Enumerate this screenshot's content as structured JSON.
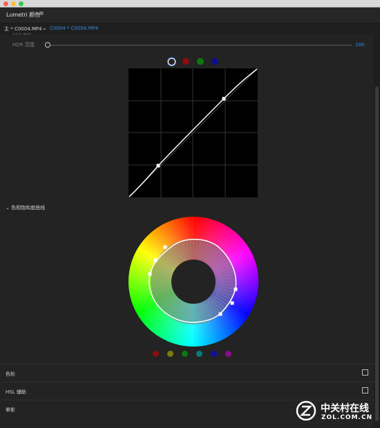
{
  "panel": {
    "title": "Lumetri 颜色",
    "menu_icon": "hamburger-menu-icon"
  },
  "clip_bar": {
    "main_clip": "主 * C0004.MP4",
    "active_clip": "C0004 * C0004.MP4"
  },
  "hdr": {
    "clipped_label": "RGB 曲线",
    "label": "HDR 范围",
    "value": "100"
  },
  "rgb_curves": {
    "channels": [
      {
        "name": "white-channel",
        "color": "#ffffff",
        "selected": true
      },
      {
        "name": "red-channel",
        "color": "#8b0d0d",
        "selected": false
      },
      {
        "name": "green-channel",
        "color": "#0b7a0b",
        "selected": false
      },
      {
        "name": "blue-channel",
        "color": "#0d0d8b",
        "selected": false
      }
    ]
  },
  "hue_sat": {
    "title": "色相饱和度曲线",
    "hue_dots": [
      {
        "name": "red-hue",
        "color": "#8b0d0d"
      },
      {
        "name": "yellow-hue",
        "color": "#7f7a0b"
      },
      {
        "name": "green-hue",
        "color": "#0b7a0b"
      },
      {
        "name": "cyan-hue",
        "color": "#0a7a7a"
      },
      {
        "name": "blue-hue",
        "color": "#0f0fa0"
      },
      {
        "name": "magenta-hue",
        "color": "#8b0b8b"
      }
    ]
  },
  "sections": {
    "color_wheels": "色轮",
    "hsl_secondary": "HSL 辅助",
    "vignette": "晕影"
  },
  "watermark": {
    "cn": "中关村在线",
    "en": "ZOL.COM.CN"
  },
  "colors": {
    "accent": "#2d8ceb",
    "background": "#232323"
  }
}
